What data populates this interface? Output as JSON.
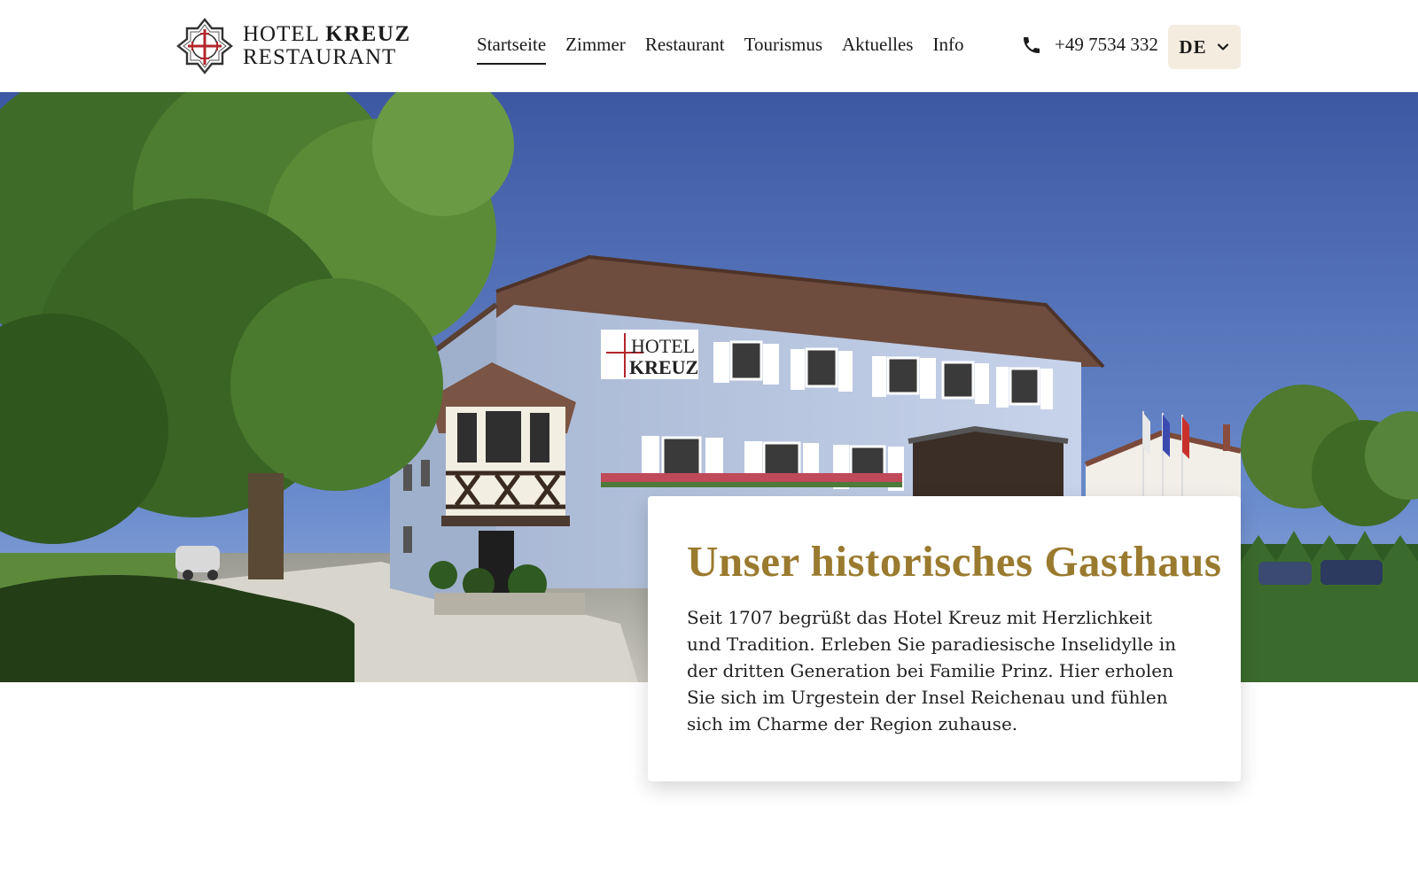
{
  "brand": {
    "name_line1_regular": "HOTEL",
    "name_line1_bold": "KREUZ",
    "name_line2": "RESTAURANT",
    "logo_icon": "cross-emblem-icon",
    "accent_color": "#9a7a2e",
    "cross_color": "#b3262c"
  },
  "nav": {
    "items": [
      {
        "label": "Startseite",
        "active": true
      },
      {
        "label": "Zimmer",
        "active": false
      },
      {
        "label": "Restaurant",
        "active": false
      },
      {
        "label": "Tourismus",
        "active": false
      },
      {
        "label": "Aktuelles",
        "active": false
      },
      {
        "label": "Info",
        "active": false
      }
    ]
  },
  "contact": {
    "phone_icon": "phone-icon",
    "phone": "+49 7534 332"
  },
  "language": {
    "selected": "DE",
    "icon": "chevron-down-icon",
    "background": "#f4ecdf"
  },
  "hero": {
    "image_icon": "hotel-building-photo",
    "sign_line1": "HOTEL",
    "sign_line2": "KREUZ"
  },
  "intro": {
    "title": "Unser historisches Gasthaus",
    "text": "Seit 1707 begrüßt das Hotel Kreuz mit Herzlichkeit und Tradition. Erleben Sie paradiesische Inselidylle in der dritten Generation bei Familie Prinz. Hier erholen Sie sich im Urgestein der Insel Reichenau und fühlen sich im Charme der Region zuhause."
  }
}
